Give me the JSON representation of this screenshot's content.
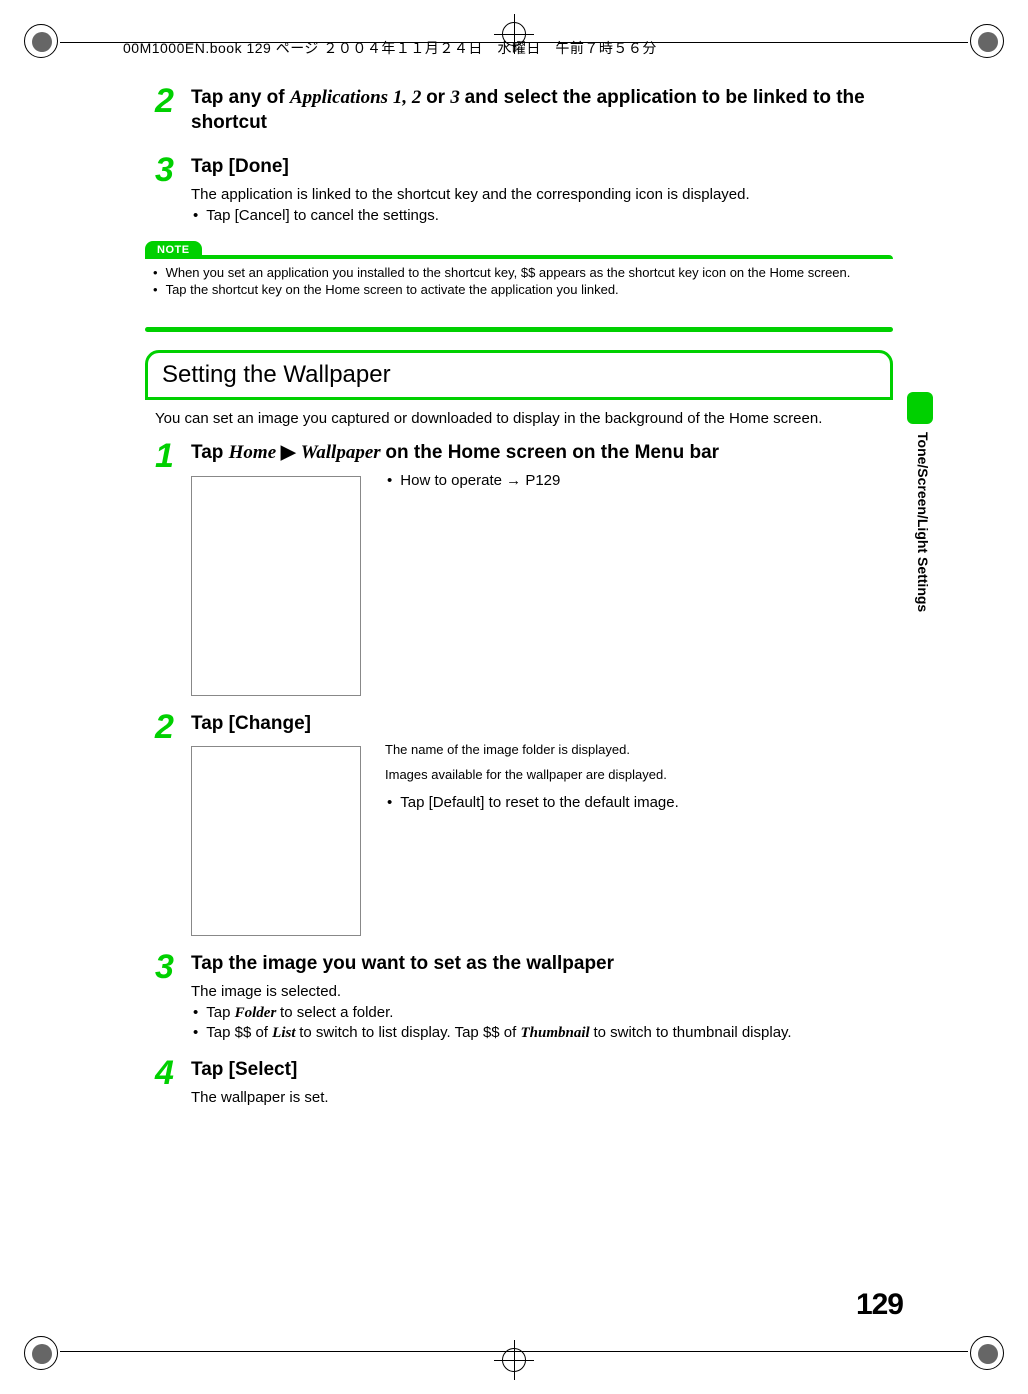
{
  "header_line": "00M1000EN.book  129 ページ  ２００４年１１月２４日　水曜日　午前７時５６分",
  "side_label": "Tone/Screen/Light Settings",
  "page_number": "129",
  "shortcut": {
    "step2": {
      "prefix": "Tap any of ",
      "italic1": "Applications 1, 2 ",
      "mid": "or ",
      "italic2": "3 ",
      "suffix": "and select the application to be linked to the shortcut"
    },
    "step3": {
      "title": "Tap [Done]",
      "desc": "The application is linked to the shortcut key and the corresponding icon is displayed.",
      "bullet1": "Tap [Cancel] to cancel the settings."
    }
  },
  "note": {
    "label": "NOTE",
    "item1": "When you set an application you installed to the shortcut key, $$ appears as the shortcut key icon on the Home screen.",
    "item2": "Tap the shortcut key on the Home screen to activate the application you linked."
  },
  "wall": {
    "section_title": "Setting the Wallpaper",
    "intro": "You can set an image you captured or downloaded to display in the background of the Home screen.",
    "step1": {
      "prefix": "Tap ",
      "i1": "Home ",
      "arrow": "▶ ",
      "i2": "Wallpaper ",
      "suffix": "on the Home screen on the Menu bar",
      "note": "How to operate → P129"
    },
    "step2": {
      "title": "Tap [Change]",
      "line1": "The name of the image folder is displayed.",
      "line2": "Images available for the wallpaper are displayed.",
      "bullet": "Tap [Default] to reset to the default image."
    },
    "step3": {
      "title": "Tap the image you want to set as the wallpaper",
      "desc": "The image is selected.",
      "b1a": "Tap ",
      "b1i": "Folder ",
      "b1b": "to select a folder.",
      "b2a": "Tap $$ of ",
      "b2i1": "List ",
      "b2b": "to switch to list display. Tap $$ of ",
      "b2i2": "Thumbnail ",
      "b2c": "to switch to thumbnail display."
    },
    "step4": {
      "title": "Tap [Select]",
      "desc": "The wallpaper is set."
    }
  }
}
